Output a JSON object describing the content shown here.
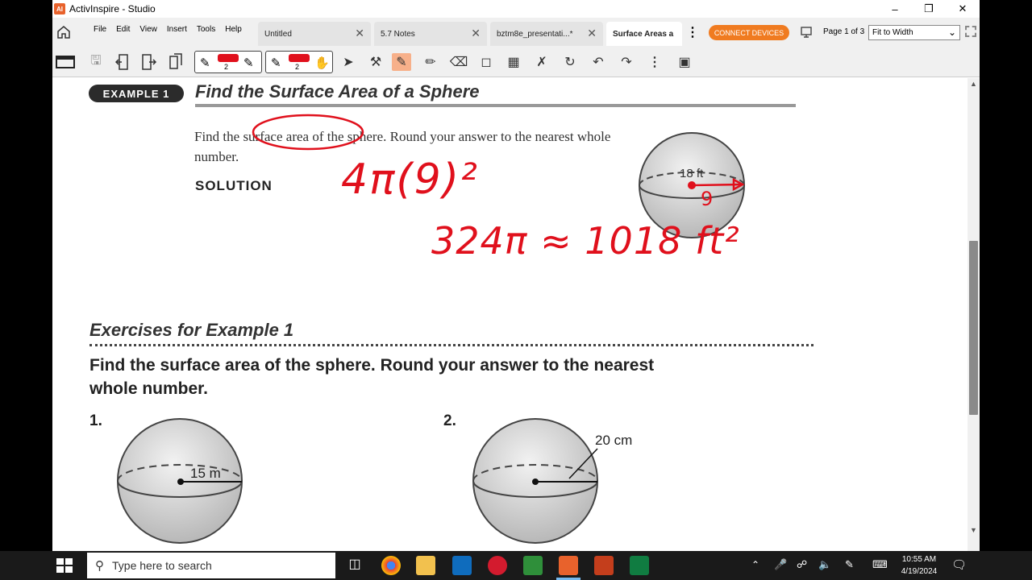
{
  "window": {
    "title": "ActivInspire - Studio",
    "icon_label": "AI"
  },
  "menu": [
    "File",
    "Edit",
    "View",
    "Insert",
    "Tools",
    "Help"
  ],
  "tabs": [
    {
      "label": "Untitled"
    },
    {
      "label": "5.7 Notes"
    },
    {
      "label": "bztm8e_presentati...*"
    },
    {
      "label": "Surface Areas a"
    }
  ],
  "header": {
    "connect_label": "CONNECT DEVICES",
    "page_indicator": "Page 1 of 3",
    "zoom_value": "Fit to Width"
  },
  "pen_tools": [
    {
      "width": "2"
    },
    {
      "width": "2"
    }
  ],
  "content": {
    "example_badge": "EXAMPLE 1",
    "example_title": "Find the Surface Area of a Sphere",
    "problem_text": "Find the surface area of the sphere. Round your answer to the nearest whole number.",
    "solution_label": "SOLUTION",
    "sphere_label": "18 ft",
    "exercises_title": "Exercises for Example 1",
    "instruction": "Find the surface area of the sphere. Round your answer to the nearest whole number.",
    "exercises": [
      {
        "number": "1.",
        "label": "15 m"
      },
      {
        "number": "2.",
        "label": "20 cm"
      }
    ]
  },
  "annotations": {
    "line1": "4π(9)²",
    "line2": "324π ≈ 1018 ft²",
    "radius_mark": "9",
    "color": "#e0101c"
  },
  "taskbar": {
    "search_placeholder": "Type here to search",
    "time": "10:55 AM",
    "date": "4/19/2024"
  }
}
